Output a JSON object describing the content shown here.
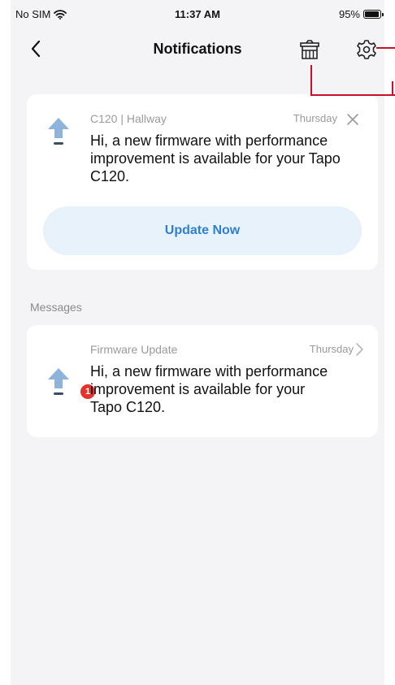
{
  "status_bar": {
    "carrier": "No SIM",
    "time": "11:37 AM",
    "battery": "95%",
    "battery_level": 0.95
  },
  "nav": {
    "title": "Notifications",
    "back_icon": "chevron-left-icon",
    "delete_icon": "trash-basket-icon",
    "settings_icon": "gear-icon"
  },
  "banner_card": {
    "source": "C120 | Hallway",
    "day": "Thursday",
    "message": "Hi, a new firmware with performance improvement is available for your Tapo C120.",
    "button_label": "Update Now",
    "icon": "firmware-upload-icon"
  },
  "messages_section": {
    "title": "Messages",
    "items": [
      {
        "title": "Firmware Update",
        "day": "Thursday",
        "message": "Hi, a new firmware with performance improvement is available for your Tapo C120.",
        "badge_count": "1",
        "icon": "firmware-upload-icon"
      }
    ]
  },
  "colors": {
    "accent_blue": "#2f7fd2",
    "button_bg": "#e8f2fb",
    "badge_red": "#e5322d",
    "annotation_red": "#c8102e",
    "background": "#f4f4f6"
  }
}
